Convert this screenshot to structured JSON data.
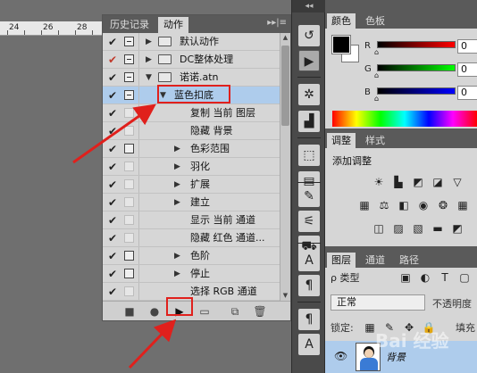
{
  "ruler": {
    "ticks": [
      "24",
      "26",
      "28"
    ]
  },
  "actions_panel": {
    "tabs": [
      "历史记录",
      "动作"
    ],
    "menu_glyph": "▸▸|≡",
    "rows": [
      {
        "label": "默认动作",
        "check": "✔",
        "dialog": "inner",
        "kind": "folder",
        "expanded": false
      },
      {
        "label": "DC整体处理",
        "check": "✔",
        "check_red": true,
        "dialog": "inner",
        "kind": "folder",
        "expanded": false
      },
      {
        "label": "诺诺.atn",
        "check": "✔",
        "dialog": "inner",
        "kind": "folder",
        "expanded": true
      },
      {
        "label": "蓝色扣底",
        "check": "✔",
        "dialog": "inner",
        "kind": "action",
        "expanded": true,
        "selected": true
      },
      {
        "label": "复制 当前 图层",
        "check": "✔",
        "dialog": "faint",
        "kind": "step"
      },
      {
        "label": "隐藏 背景",
        "check": "✔",
        "dialog": "faint",
        "kind": "step"
      },
      {
        "label": "色彩范围",
        "check": "✔",
        "dialog": "box",
        "kind": "step",
        "expandable": true
      },
      {
        "label": "羽化",
        "check": "✔",
        "dialog": "faint",
        "kind": "step",
        "expandable": true
      },
      {
        "label": "扩展",
        "check": "✔",
        "dialog": "faint",
        "kind": "step",
        "expandable": true
      },
      {
        "label": "建立",
        "check": "✔",
        "dialog": "faint",
        "kind": "step",
        "expandable": true
      },
      {
        "label": "显示 当前 通道",
        "check": "✔",
        "dialog": "faint",
        "kind": "step"
      },
      {
        "label": "隐藏 红色 通道...",
        "check": "✔",
        "dialog": "faint",
        "kind": "step"
      },
      {
        "label": "色阶",
        "check": "✔",
        "dialog": "box",
        "kind": "step",
        "expandable": true
      },
      {
        "label": "停止",
        "check": "✔",
        "dialog": "box",
        "kind": "step",
        "expandable": true
      },
      {
        "label": "选择 RGB 通道",
        "check": "✔",
        "dialog": "faint",
        "kind": "step"
      }
    ],
    "bottom_buttons": [
      "stop-icon",
      "record-icon",
      "play-icon",
      "new-set-icon",
      "new-action-icon",
      "delete-icon"
    ]
  },
  "toolstrip": {
    "collapse_glyph": "◂◂"
  },
  "color_panel": {
    "tabs": [
      "颜色",
      "色板"
    ],
    "channels": [
      {
        "name": "R",
        "value": "0",
        "gradient": [
          "#000000",
          "#ff0000"
        ]
      },
      {
        "name": "G",
        "value": "0",
        "gradient": [
          "#000000",
          "#00ff00"
        ]
      },
      {
        "name": "B",
        "value": "0",
        "gradient": [
          "#000000",
          "#0000ff"
        ]
      }
    ]
  },
  "adjustments_panel": {
    "tabs": [
      "调整",
      "样式"
    ],
    "title": "添加调整"
  },
  "layers_panel": {
    "tabs": [
      "图层",
      "通道",
      "路径"
    ],
    "kind_filter": "ρ 类型",
    "blend_mode": "正常",
    "opacity_label": "不透明度",
    "lock_label": "锁定:",
    "fill_label": "填充",
    "layer_name": "背景"
  },
  "watermark": "Bai 经验"
}
